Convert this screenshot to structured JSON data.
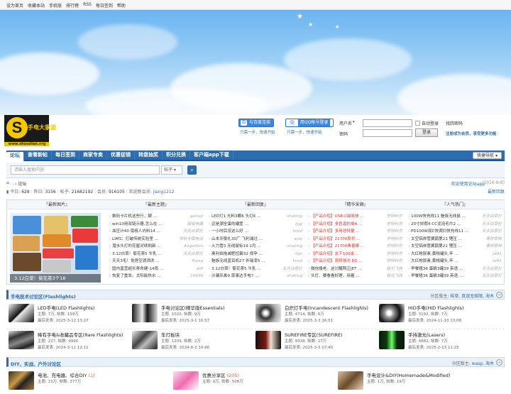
{
  "topbar": {
    "links": [
      "设为首页",
      "收藏本站",
      "手机版",
      "排行榜",
      "RSS",
      "每日签到",
      "帮助"
    ]
  },
  "logo": {
    "mark": "S",
    "name": "手电大家谈",
    "url": "www.shoudian.org"
  },
  "login": {
    "baidu_label": "与百度连接",
    "baidu_tip": "只需一步，快速开始",
    "qq_label": "用QQ帐号登录",
    "qq_tip": "只需一步，快速开始",
    "user_label": "用户名",
    "pass_label": "密码",
    "auto_login": "自动登录",
    "forgot": "找回密码",
    "login_btn": "登录",
    "register": "注册成为会员，享受更多功能"
  },
  "nav": {
    "items": [
      "论坛",
      "查看新帖",
      "每日签到",
      "商家专卖",
      "优惠促销",
      "转盘抽奖",
      "积分兑换",
      "客户端app下载"
    ],
    "quick": "快捷导航"
  },
  "search": {
    "placeholder": "请输入搜索内容",
    "scope": "帖子"
  },
  "breadcrumb": {
    "path": "论坛",
    "app_link": "欢迎使用论坛app",
    "date": "(2016-8-8)"
  },
  "stats": {
    "today_label": "今日:",
    "today": "628",
    "yesterday_label": "昨日:",
    "yesterday": "3156",
    "posts_label": "帖子:",
    "posts": "21682192",
    "members_label": "会员:",
    "members": "916105",
    "welcome_label": "欢迎新会员:",
    "newest": "jiang1212",
    "latest_reply": "最新回复"
  },
  "tabs": {
    "headers": [
      "『最新图片』",
      "『最新主题』",
      "『最新回复』",
      "『精华采撷』",
      "『人气热门』"
    ],
    "photo_caption": "3.12白菜！菊花茶3个18",
    "topics": [
      {
        "t": "数码卡片机这些行，脚 ...",
        "a": "qellsqi"
      },
      {
        "t": "win10用双链示器,怎么在 ...",
        "a": "超级电鹰"
      },
      {
        "t": "血压计40 南极人内料14 ...",
        "a": "天天白菜价"
      },
      {
        "t": "LIMS：打破传统实验室 ...",
        "a": "体检全国电话"
      },
      {
        "t": "潜水头灯的花屋对续刷新 ...",
        "a": "AngelAnn"
      },
      {
        "t": "3.12白菜！菊花茶5 牛乳 ...",
        "a": "天天白菜价"
      },
      {
        "t": "天天3毛！免搭空调洒洗 ...",
        "a": "ffaiaa"
      },
      {
        "t": "国内直营超长寿命硬-14雨 ...",
        "a": "ddf"
      },
      {
        "t": "恢复了重发。太阳能热水 ...",
        "a": "19438"
      }
    ],
    "replies": [
      {
        "t": "LED灯1 光料3颗6 头灯6 ...",
        "a": "shaking"
      },
      {
        "t": "迈是潮全蛋的罐筐 ...",
        "a": "lyqj"
      },
      {
        "t": "一小时后没这么好 ...",
        "a": "lmzd"
      },
      {
        "t": "山本牙鬃礼30厂 飞利浦过 ...",
        "a": "ayaj"
      },
      {
        "t": "火力管3 无线鼠标19 2月 ...",
        "a": "shaking"
      },
      {
        "t": "奥利伯拖减肥控霸32 视孕 ...",
        "a": "rhjh"
      },
      {
        "t": "魅族无线蓝耳机27 补瑞漆5 ...",
        "a": "lmzd"
      },
      {
        "t": "3.12白菜！菊花茶5 牛乳 ...",
        "a": "天天白菜价"
      },
      {
        "t": "沙漏灰鼻9 荣事达手电7 ...",
        "a": "shaking"
      }
    ],
    "digest": [
      {
        "t": "【产品介绍】USB-C磁吸快 ...",
        "a": "奈特科尔"
      },
      {
        "t": "【产品介绍】多色温的曼A ...",
        "a": "奈特科尔"
      },
      {
        "t": "【产品介绍】多用途特量 ...",
        "a": "奈特科尔"
      },
      {
        "t": "【产品介绍】21700系列 ...",
        "a": "奈特科尔"
      },
      {
        "t": "【产品介绍】21700青春脚 ...",
        "a": "奈特科尔"
      },
      {
        "t": "【产品介绍】水下100米 ...",
        "a": "奈特科尔"
      },
      {
        "t": "【产品介绍】奈特强光 ED ...",
        "a": "奈特科尔"
      },
      {
        "t": "微信搂老。这讨醒照正JET ...",
        "a": "极光飞侠"
      },
      {
        "t": "头灯、要看看好理，用着 ...",
        "a": "极光飞侠"
      }
    ],
    "hot": [
      {
        "t": "100W快充线11 魅族无线鼠 ...",
        "a": "天天白菜价"
      },
      {
        "t": "20寸拼假4 CC泥泡毛巾2 ...",
        "a": "天天白菜价"
      },
      {
        "t": "PD100W双C快调扫快充线11 ...",
        "a": "天天白菜价"
      },
      {
        "t": "太空铝岸管翼鹊第21 锂压 ...",
        "a": "青树翠林"
      },
      {
        "t": "太空铝岸管翼鹊第21 锂压 ...",
        "a": "青树翠林"
      },
      {
        "t": "大红枪尿素,黄桃罐头,辛 ...",
        "a": "liz91"
      },
      {
        "t": "大红枪尿素,黄桃罐头,辛 ...",
        "a": "liz91"
      },
      {
        "t": "早餐粗36 蛋糕3罐39 英语 ...",
        "a": "天天白菜价"
      },
      {
        "t": "早餐粗36 蛋糕3罐39 英语 ...",
        "a": "天天白菜价"
      }
    ]
  },
  "sections": [
    {
      "title": "手电技术讨论区(Flashlights)",
      "mods_label": "分区版主:",
      "mods": "稻草, 真谊无极限, 海木",
      "forums": [
        {
          "name": "LED手电(LED Flashlights)",
          "stat": "主题: 7万, 帖数: 159万",
          "last": "最后发表: 2025-3-12 13:27"
        },
        {
          "name": "手电讨论区(精华版Essentials)",
          "stat": "主题: 1020, 帖数: 9万",
          "last": "最后发表: 2025-3-1 16:57"
        },
        {
          "name": "白炽灯手电(Incandescent Flashlights)",
          "stat": "主题: 4714, 帖数: 6万",
          "last": "最后发表: 2025-3-3 16:51"
        },
        {
          "name": "HID手电(HID Flashlights)",
          "stat": "主题: 3192, 帖数: 7万",
          "last": "最后发表: 2024-11-10 13:08"
        },
        {
          "name": "稀有手电&收藏品专区(Rare Flashlights)",
          "stat": "主题: 227, 帖数: 9990",
          "last": "最后发表: 2024-3-12 12:11"
        },
        {
          "name": "车灯板块",
          "stat": "主题: 1209, 帖数: 2万",
          "last": "最后发表: 2024-8-2 10:46"
        },
        {
          "name": "SUREFIRE专区(SUREFIRE)",
          "stat": "主题: 9338, 帖数: 27万",
          "last": "最后发表: 2025-3-5 07:40"
        },
        {
          "name": "手持激光(Lasers)",
          "stat": "主题: 4882, 帖数: 7万",
          "last": "最后发表: 2025-2-13 11:25"
        }
      ]
    },
    {
      "title": "DIY、实战、户外讨论区",
      "mods_label": "分区版主:",
      "mods": "wasp, 海木",
      "forums": [
        {
          "name": "电池、充电器、综合DIY",
          "new": "(1)",
          "stat": "主题: 15万, 帖数: 377万",
          "last": ""
        },
        {
          "name": "优惠分享区",
          "new": "(205)",
          "stat": "主题: 9万, 帖数: 508万",
          "last": ""
        },
        {
          "name": "手电设计&DIY(Homemade&Modified)",
          "stat": "主题: 1万, 帖数: 19万",
          "last": ""
        }
      ]
    }
  ],
  "colors": {
    "nav": "#2d6cad",
    "accent_red": "#e0302a",
    "logo_yellow": "#f5c800"
  }
}
